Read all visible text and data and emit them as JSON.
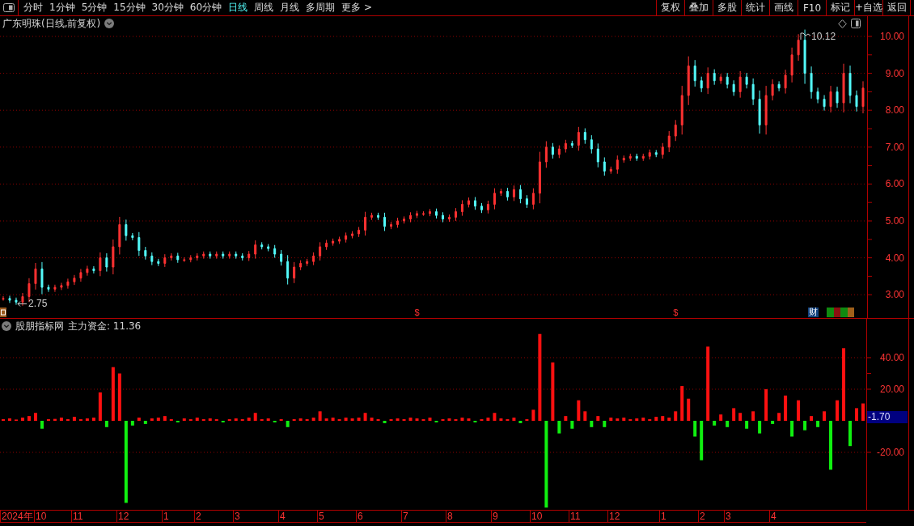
{
  "toolbar": {
    "tabs": [
      {
        "label": "分时",
        "selected": false
      },
      {
        "label": "1分钟",
        "selected": false
      },
      {
        "label": "5分钟",
        "selected": false
      },
      {
        "label": "15分钟",
        "selected": false
      },
      {
        "label": "30分钟",
        "selected": false
      },
      {
        "label": "60分钟",
        "selected": false
      },
      {
        "label": "日线",
        "selected": true
      },
      {
        "label": "周线",
        "selected": false
      },
      {
        "label": "月线",
        "selected": false
      },
      {
        "label": "多周期",
        "selected": false
      },
      {
        "label": "更多 >",
        "selected": false
      }
    ],
    "buttons": [
      "复权",
      "叠加",
      "多股",
      "统计",
      "画线",
      "F10",
      "标记",
      "+自选",
      "返回"
    ]
  },
  "price_chart": {
    "title": "广东明珠(日线,前复权)",
    "high_label": "10.12",
    "low_label": "2.75",
    "dividend_marks": [
      "$",
      "$"
    ],
    "finance_badge": "财",
    "axis_labels": [
      "10.00",
      "9.00",
      "8.00",
      "7.00",
      "6.00",
      "5.00",
      "4.00",
      "3.00"
    ]
  },
  "indicator": {
    "name": "股朋指标网",
    "reading": "主力资金: 11.36",
    "last_value": "-1.70",
    "chart_data": {
      "type": "bar",
      "ylim": [
        -56.4,
        64.6
      ],
      "yticks": [
        {
          "value": 40,
          "label": "40.00"
        },
        {
          "value": 20,
          "label": "20.00"
        },
        {
          "value": -20,
          "label": "-20.00"
        }
      ],
      "grid": true,
      "values": [
        1,
        1.5,
        0.8,
        2,
        3,
        5,
        -5,
        1,
        1.2,
        2,
        1,
        2.5,
        1,
        1.5,
        2,
        18,
        -4,
        34,
        30,
        -52,
        -3,
        2,
        -2,
        1.5,
        2,
        3,
        1,
        -1,
        1.5,
        1,
        2,
        1,
        1.5,
        1,
        -1,
        1,
        1.5,
        1,
        2,
        5,
        1,
        1.5,
        -1,
        1,
        -4,
        1,
        1.5,
        1,
        2,
        6,
        1.5,
        2,
        1,
        2,
        1.5,
        2,
        5,
        2,
        1,
        -1.5,
        1,
        1.5,
        1,
        2,
        1.5,
        1,
        2,
        -1,
        1,
        1.5,
        1,
        2,
        1.5,
        -1,
        1,
        2,
        5,
        1.5,
        1,
        2,
        -1.5,
        1,
        7,
        55,
        -55,
        37,
        -8,
        3,
        -5,
        13,
        6,
        -4,
        3,
        -4,
        2,
        1.5,
        2,
        1,
        1.5,
        2,
        1,
        2.5,
        3,
        2,
        6,
        22,
        14,
        -10,
        -25,
        47,
        -3,
        4,
        -4,
        8,
        5,
        -5,
        6,
        -8,
        20,
        -2,
        5,
        16,
        -10,
        13,
        -6,
        3,
        -4,
        6,
        -31,
        13,
        46,
        -16,
        8,
        11
      ]
    }
  },
  "date_axis": [
    "2024年",
    "10",
    "11",
    "12",
    "1",
    "2",
    "3",
    "4",
    "5",
    "6",
    "7",
    "8",
    "9",
    "10",
    "11",
    "12",
    "1",
    "2",
    "3",
    "4"
  ]
}
